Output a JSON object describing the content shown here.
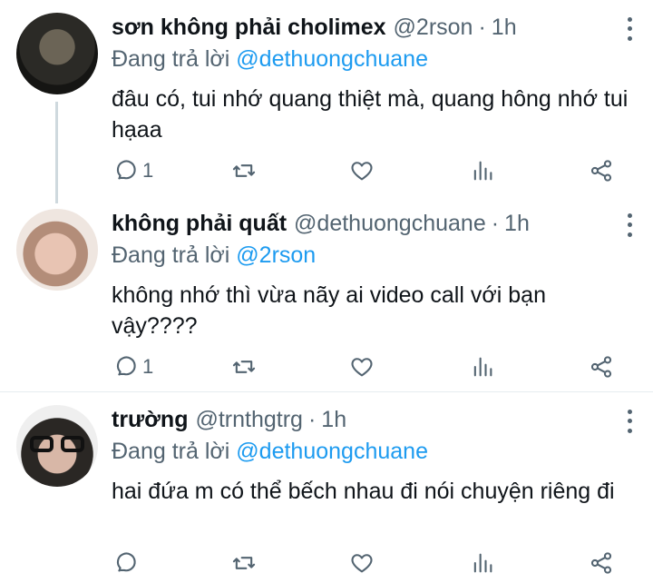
{
  "replies": [
    {
      "display_name": "sơn không phải cholimex",
      "handle": "@2rson",
      "separator": "·",
      "time": "1h",
      "reply_prefix": "Đang trả lời",
      "reply_to": "@dethuongchuane",
      "text": "đâu có, tui nhớ quang thiệt mà, quang hông nhớ tui hạaa",
      "reply_count": "1"
    },
    {
      "display_name": "không phải quất",
      "handle": "@dethuongchuane",
      "separator": "·",
      "time": "1h",
      "reply_prefix": "Đang trả lời",
      "reply_to": "@2rson",
      "text": "không nhớ thì vừa nãy ai video call với bạn vậy????",
      "reply_count": "1"
    },
    {
      "display_name": "trường",
      "handle": "@trnthgtrg",
      "separator": "·",
      "time": "1h",
      "reply_prefix": "Đang trả lời",
      "reply_to": "@dethuongchuane",
      "text": "hai đứa m có thể bếch nhau đi nói chuyện riêng đi",
      "reply_count": ""
    }
  ],
  "icons": [
    "reply-icon",
    "retweet-icon",
    "like-icon",
    "stats-icon",
    "share-icon",
    "more-icon"
  ],
  "colors": {
    "link": "#1d9bf0",
    "secondary_text": "#536471",
    "primary_text": "#0f1419",
    "thread_line": "#cfd9de"
  }
}
